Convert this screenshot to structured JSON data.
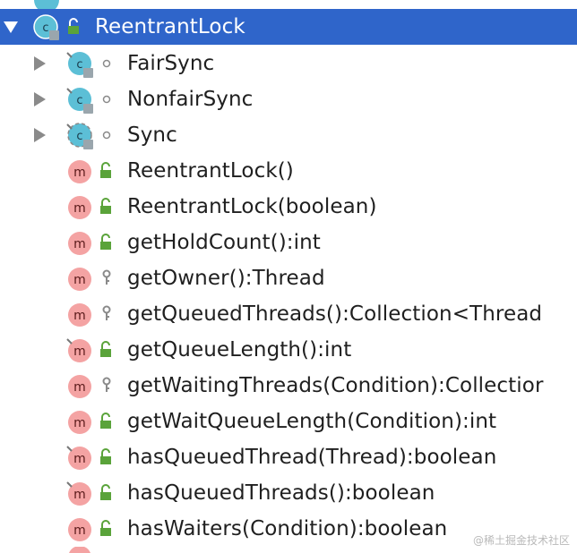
{
  "tree": {
    "root": {
      "label": "ReentrantLock",
      "icon": "class-icon",
      "visibility": "public"
    },
    "children": [
      {
        "label": "FairSync",
        "icon": "inner-class-icon",
        "visibility": "package-private",
        "expandable": true
      },
      {
        "label": "NonfairSync",
        "icon": "inner-class-icon",
        "visibility": "package-private",
        "expandable": true
      },
      {
        "label": "Sync",
        "icon": "abstract-class-icon",
        "visibility": "package-private",
        "expandable": true
      },
      {
        "label": "ReentrantLock()",
        "icon": "method-icon",
        "visibility": "public"
      },
      {
        "label": "ReentrantLock(boolean)",
        "icon": "method-icon",
        "visibility": "public"
      },
      {
        "label": "getHoldCount():int",
        "icon": "method-icon",
        "visibility": "public"
      },
      {
        "label": "getOwner():Thread",
        "icon": "method-icon",
        "visibility": "protected"
      },
      {
        "label": "getQueuedThreads():Collection<Thread",
        "icon": "method-icon",
        "visibility": "protected"
      },
      {
        "label": "getQueueLength():int",
        "icon": "final-method-icon",
        "visibility": "public"
      },
      {
        "label": "getWaitingThreads(Condition):Collectior",
        "icon": "method-icon",
        "visibility": "protected"
      },
      {
        "label": "getWaitQueueLength(Condition):int",
        "icon": "method-icon",
        "visibility": "public"
      },
      {
        "label": "hasQueuedThread(Thread):boolean",
        "icon": "final-method-icon",
        "visibility": "public"
      },
      {
        "label": "hasQueuedThreads():boolean",
        "icon": "final-method-icon",
        "visibility": "public"
      },
      {
        "label": "hasWaiters(Condition):boolean",
        "icon": "method-icon",
        "visibility": "public"
      }
    ]
  },
  "colors": {
    "selection": "#2f65ca",
    "method_icon": "#f4a3a3",
    "class_icon": "#5cbfd6",
    "public_lock": "#5aa33a"
  },
  "watermark": "@稀土掘金技术社区"
}
